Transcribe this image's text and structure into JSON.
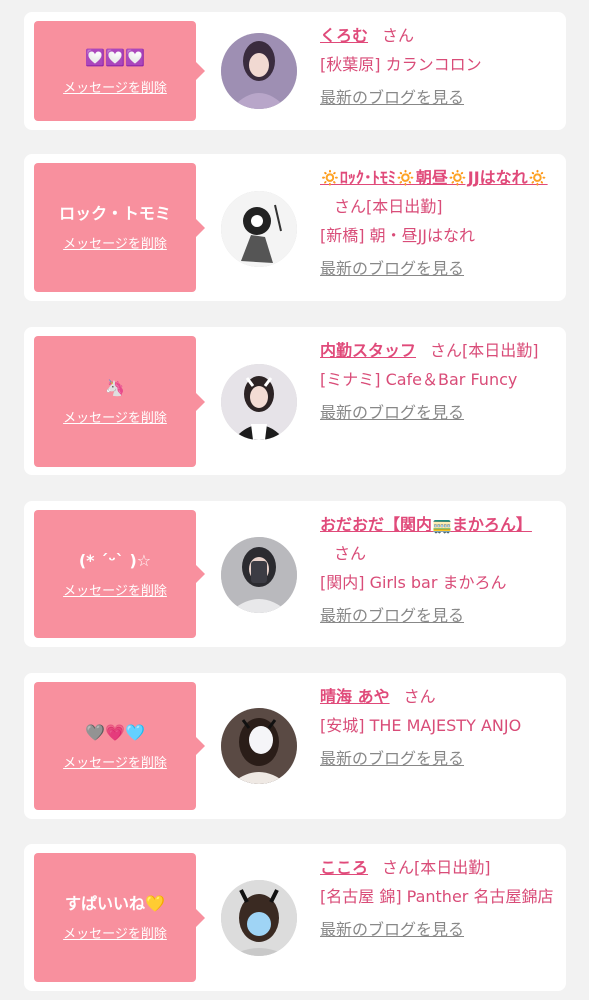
{
  "common": {
    "delete_label": "メッセージを削除",
    "blog_label": "最新のブログを見る",
    "san": "さん",
    "accent_color": "#f8909e",
    "name_color": "#e04a7a"
  },
  "items": [
    {
      "bubble_text": "💟💟💟",
      "name": "くろむ",
      "suffix": "",
      "shop": "[秋葉原] カランコロン"
    },
    {
      "bubble_text": "ロック・トモミ",
      "name": "🔅ﾛｯｸ･ﾄﾓﾐ🔅朝昼🔅JJはなれ🔅",
      "suffix": "[本日出勤]",
      "shop": "[新橋] 朝・昼JJはなれ"
    },
    {
      "bubble_text": "🦄",
      "name": "内勤スタッフ",
      "suffix": "[本日出勤]",
      "shop": "[ミナミ] Cafe＆Bar Funcy"
    },
    {
      "bubble_text": "(* ˊᵕˋ )☆",
      "name": "おだおだ【関内🚃まかろん】",
      "suffix": "",
      "shop": "[関内] Girls bar まかろん"
    },
    {
      "bubble_text": "🩶💗🩵",
      "name": "晴海 あや",
      "suffix": "",
      "shop": "[安城] THE MAJESTY ANJO"
    },
    {
      "bubble_text": "すぱいいね💛",
      "name": "こころ",
      "suffix": "[本日出勤]",
      "shop": "[名古屋 錦] Panther 名古屋錦店"
    }
  ]
}
